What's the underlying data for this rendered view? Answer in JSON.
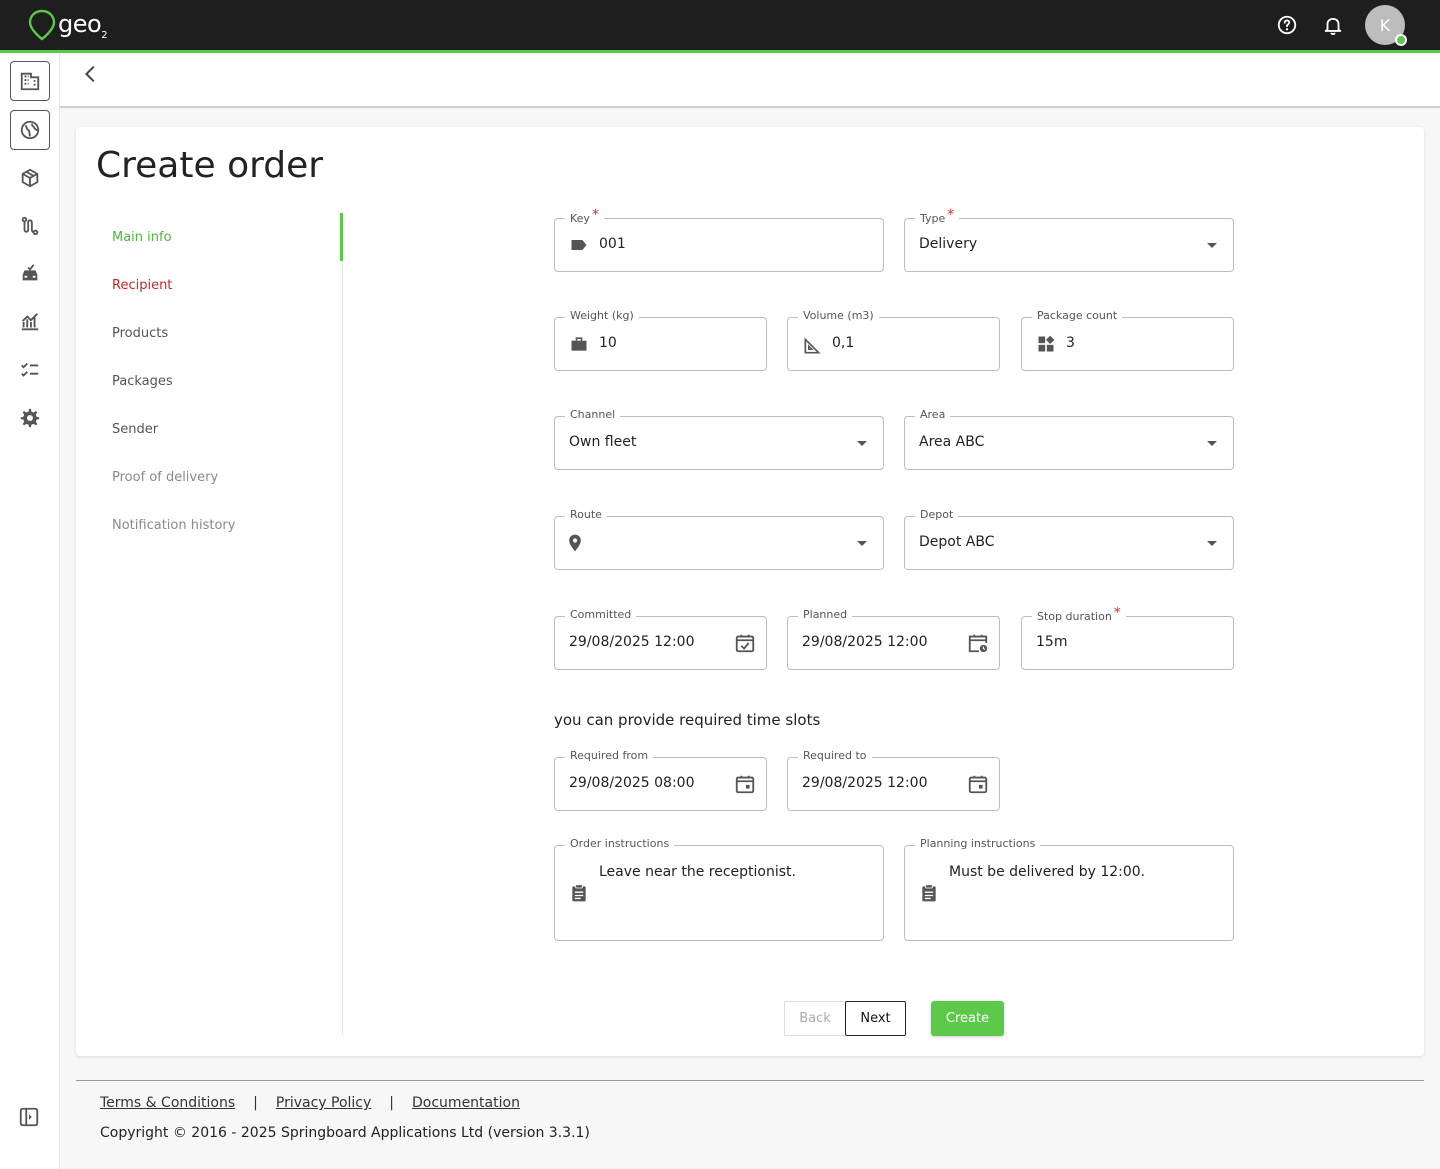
{
  "app": {
    "logo_text": "geo",
    "logo_sub": "2",
    "avatar_initial": "K",
    "accent": "#5cc94a"
  },
  "sidebar": {
    "items": [
      {
        "icon": "building-icon"
      },
      {
        "icon": "globe-icon"
      },
      {
        "icon": "package-icon"
      },
      {
        "icon": "route-icon"
      },
      {
        "icon": "vehicle-icon"
      },
      {
        "icon": "analytics-icon"
      },
      {
        "icon": "checklist-icon"
      },
      {
        "icon": "settings-icon"
      }
    ]
  },
  "page": {
    "title": "Create order"
  },
  "steps": [
    {
      "label": "Main info",
      "state": "active"
    },
    {
      "label": "Recipient",
      "state": "error"
    },
    {
      "label": "Products",
      "state": "normal"
    },
    {
      "label": "Packages",
      "state": "normal"
    },
    {
      "label": "Sender",
      "state": "normal"
    },
    {
      "label": "Proof of delivery",
      "state": "disabled"
    },
    {
      "label": "Notification history",
      "state": "disabled"
    }
  ],
  "form": {
    "key": {
      "label": "Key",
      "value": "001",
      "required": "*"
    },
    "type": {
      "label": "Type",
      "value": "Delivery",
      "required": "*"
    },
    "weight": {
      "label": "Weight (kg)",
      "value": "10"
    },
    "volume": {
      "label": "Volume (m3)",
      "value": "0,1"
    },
    "package_count": {
      "label": "Package count",
      "value": "3"
    },
    "channel": {
      "label": "Channel",
      "value": "Own fleet"
    },
    "area": {
      "label": "Area",
      "value": "Area ABC"
    },
    "route": {
      "label": "Route",
      "value": ""
    },
    "depot": {
      "label": "Depot",
      "value": "Depot ABC"
    },
    "committed": {
      "label": "Committed",
      "value": "29/08/2025 12:00"
    },
    "planned": {
      "label": "Planned",
      "value": "29/08/2025 12:00"
    },
    "stop_duration": {
      "label": "Stop duration",
      "value": "15m",
      "required": "*"
    },
    "time_slots_hint": "you can provide required time slots",
    "required_from": {
      "label": "Required from",
      "value": "29/08/2025 08:00"
    },
    "required_to": {
      "label": "Required to",
      "value": "29/08/2025 12:00"
    },
    "order_instructions": {
      "label": "Order instructions",
      "value": "Leave near the receptionist."
    },
    "planning_instructions": {
      "label": "Planning instructions",
      "value": "Must be delivered by 12:00."
    }
  },
  "actions": {
    "back": "Back",
    "next": "Next",
    "create": "Create"
  },
  "footer": {
    "terms": "Terms & Conditions",
    "privacy": "Privacy Policy",
    "docs": "Documentation",
    "separator": "|",
    "copyright": "Copyright © 2016 - 2025 Springboard Applications Ltd (version 3.3.1)"
  }
}
